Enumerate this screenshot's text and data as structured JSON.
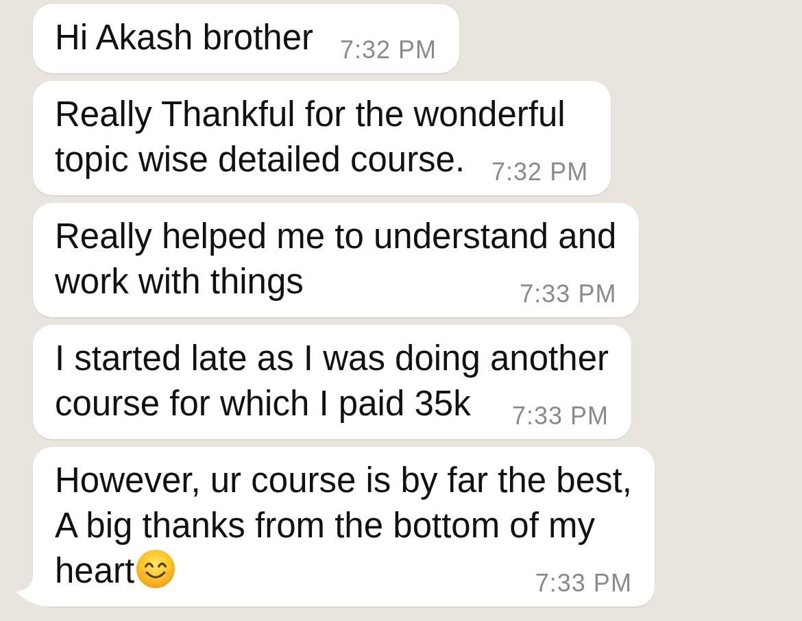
{
  "messages": [
    {
      "lines": [
        "Hi Akash brother"
      ],
      "time": "7:32 PM",
      "emoji": false,
      "tail": false
    },
    {
      "lines": [
        "Really Thankful for the wonderful",
        "topic wise detailed course."
      ],
      "time": "7:32 PM",
      "emoji": false,
      "tail": false
    },
    {
      "lines": [
        "Really helped me to understand and",
        "work with things"
      ],
      "time": "7:33 PM",
      "emoji": false,
      "tail": false
    },
    {
      "lines": [
        "I started late as I was doing another",
        "course for which I paid 35k"
      ],
      "time": "7:33 PM",
      "emoji": false,
      "tail": false
    },
    {
      "lines": [
        "However, ur course is by far the best,",
        "A big thanks from the bottom of my",
        "heart"
      ],
      "time": "7:33 PM",
      "emoji": true,
      "tail": true
    }
  ]
}
